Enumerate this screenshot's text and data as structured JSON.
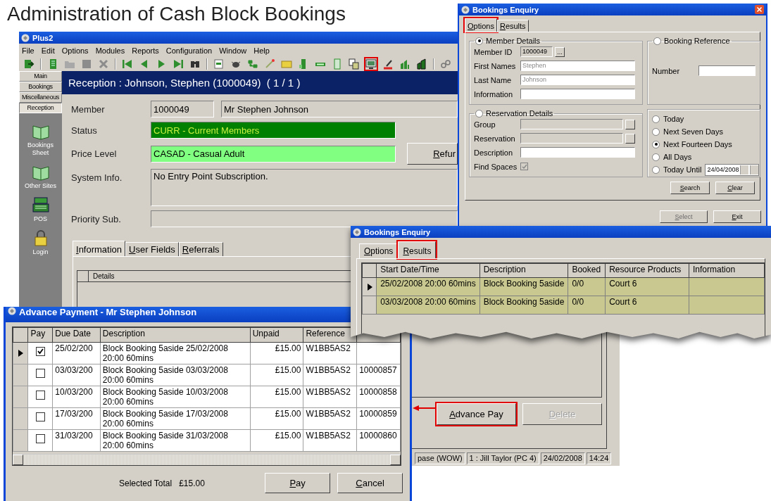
{
  "slide_title": "Administration of Cash Block Bookings",
  "main_window": {
    "title": "Plus2",
    "menu": [
      "File",
      "Edit",
      "Options",
      "Modules",
      "Reports",
      "Configuration",
      "Window",
      "Help"
    ],
    "toolbar": [
      {
        "highlighted": false
      },
      {
        "highlighted": false
      },
      {
        "highlighted": false
      },
      {
        "highlighted": false
      },
      {
        "highlighted": false
      },
      {
        "highlighted": false
      },
      {
        "highlighted": false
      },
      {
        "highlighted": false
      },
      {
        "highlighted": false
      },
      {
        "highlighted": false
      },
      {
        "highlighted": false
      },
      {
        "highlighted": false
      },
      {
        "highlighted": false
      },
      {
        "highlighted": false
      },
      {
        "highlighted": false
      },
      {
        "highlighted": false
      },
      {
        "highlighted": false
      },
      {
        "highlighted": false
      },
      {
        "highlighted": false
      },
      {
        "highlighted": true
      },
      {
        "highlighted": false
      },
      {
        "highlighted": false
      },
      {
        "highlighted": false
      },
      {
        "highlighted": false
      }
    ],
    "sidebar_tabs": [
      {
        "label": "Main",
        "selected": false
      },
      {
        "label": "Bookings",
        "selected": false
      },
      {
        "label": "Miscellaneous",
        "selected": false
      },
      {
        "label": "Reception",
        "selected": true
      }
    ],
    "sidebar_items": [
      {
        "label": "Bookings Sheet",
        "kind": "book"
      },
      {
        "label": "Other Sites",
        "kind": "book"
      },
      {
        "label": "POS",
        "kind": "till"
      },
      {
        "label": "Login",
        "kind": "lock"
      }
    ],
    "header": "Reception : Johnson, Stephen (1000049)  ( 1 / 1 )",
    "member": {
      "label": "Member",
      "id": "1000049",
      "name": "Mr Stephen Johnson"
    },
    "status": {
      "label": "Status",
      "value": "CURR - Current Members"
    },
    "price_level": {
      "label": "Price Level",
      "value": "CASAD - Casual Adult"
    },
    "refund_button": "Refur",
    "system_info": {
      "label": "System Info.",
      "value": "No Entry Point Subscription."
    },
    "priority_sub": {
      "label": "Priority Sub."
    },
    "tabs": [
      {
        "label": "Information",
        "selected": true
      },
      {
        "label": "User Fields",
        "selected": false
      },
      {
        "label": "Referrals",
        "selected": false
      }
    ],
    "details_column": "Details",
    "buttons": [
      {
        "label": "Advance Pay",
        "disabled": false,
        "highlighted": true
      },
      {
        "label": "Delete",
        "disabled": true,
        "highlighted": false
      }
    ],
    "status_bar": [
      "pase (WOW)",
      "1 : Jill Taylor (PC 4)",
      "24/02/2008",
      "14:24"
    ]
  },
  "enquiry_options": {
    "title": "Bookings Enquiry",
    "tabs": [
      {
        "label": "Options",
        "selected": true,
        "highlighted": true
      },
      {
        "label": "Results",
        "selected": false,
        "highlighted": false
      }
    ],
    "member_group": {
      "label": "Member Details",
      "selected": true,
      "fields": [
        {
          "label": "Member ID",
          "value": "1000049",
          "kind": "lookup",
          "button": "..."
        },
        {
          "label": "First Names",
          "value": "Stephen",
          "kind": "readonly"
        },
        {
          "label": "Last Name",
          "value": "Johnson",
          "kind": "readonly"
        },
        {
          "label": "Information",
          "kind": "text"
        }
      ]
    },
    "reference_group": {
      "label": "Booking Reference",
      "selected": false,
      "fields": [
        {
          "label": "Number",
          "kind": "text"
        }
      ]
    },
    "reservation_group": {
      "label": "Reservation Details",
      "selected": false,
      "fields": [
        {
          "label": "Group",
          "kind": "disabled_lookup"
        },
        {
          "label": "Reservation",
          "kind": "disabled_lookup"
        },
        {
          "label": "Description",
          "kind": "text"
        },
        {
          "label": "Find Spaces",
          "kind": "checkbox",
          "checked": true
        }
      ]
    },
    "date_range": [
      {
        "label": "Today",
        "selected": false
      },
      {
        "label": "Next Seven Days",
        "selected": false
      },
      {
        "label": "Next Fourteen Days",
        "selected": true
      },
      {
        "label": "All Days",
        "selected": false
      },
      {
        "label": "Today Until",
        "selected": false,
        "date": "24/04/2008"
      }
    ],
    "buttons": [
      {
        "label": "Search",
        "disabled": false
      },
      {
        "label": "Clear",
        "disabled": false
      }
    ],
    "footer_buttons": [
      {
        "label": "Select",
        "disabled": true
      },
      {
        "label": "Exit",
        "disabled": false
      }
    ]
  },
  "enquiry_results": {
    "title": "Bookings Enquiry",
    "tabs": [
      {
        "label": "Options",
        "selected": false,
        "highlighted": false
      },
      {
        "label": "Results",
        "selected": true,
        "highlighted": true
      }
    ],
    "columns": [
      "Start Date/Time",
      "Description",
      "Booked",
      "Resource Products",
      "Information"
    ],
    "rows": [
      {
        "selected": true,
        "start": "25/02/2008 20:00 60mins",
        "description": "Block Booking 5aside",
        "booked": "0/0",
        "resource": "Court 6"
      },
      {
        "selected": false,
        "start": "03/03/2008 20:00 60mins",
        "description": "Block Booking 5aside",
        "booked": "0/0",
        "resource": "Court 6"
      }
    ]
  },
  "advance_payment": {
    "title": "Advance Payment - Mr Stephen Johnson",
    "columns": [
      "Pay",
      "Due Date",
      "Description",
      "Unpaid",
      "Reference"
    ],
    "rows": [
      {
        "selected": true,
        "pay": true,
        "due_date": "25/02/200",
        "description": "Block Booking 5aside 25/02/2008 20:00 60mins",
        "unpaid": "£15.00",
        "reference": "W1BB5AS2"
      },
      {
        "selected": false,
        "pay": false,
        "due_date": "03/03/200",
        "description": "Block Booking 5aside 03/03/2008 20:00 60mins",
        "unpaid": "£15.00",
        "reference": "W1BB5AS2",
        "column_7": "10000857"
      },
      {
        "selected": false,
        "pay": false,
        "due_date": "10/03/200",
        "description": "Block Booking 5aside 10/03/2008 20:00 60mins",
        "unpaid": "£15.00",
        "reference": "W1BB5AS2",
        "column_7": "10000858"
      },
      {
        "selected": false,
        "pay": false,
        "due_date": "17/03/200",
        "description": "Block Booking 5aside 17/03/2008 20:00 60mins",
        "unpaid": "£15.00",
        "reference": "W1BB5AS2",
        "column_7": "10000859"
      },
      {
        "selected": false,
        "pay": false,
        "due_date": "31/03/200",
        "description": "Block Booking 5aside 31/03/2008 20:00 60mins",
        "unpaid": "£15.00",
        "reference": "W1BB5AS2",
        "column_7": "10000860"
      }
    ],
    "selected_total_label": "Selected Total",
    "selected_total": "£15.00",
    "buttons": [
      {
        "label": "Pay"
      },
      {
        "label": "Cancel"
      }
    ]
  }
}
